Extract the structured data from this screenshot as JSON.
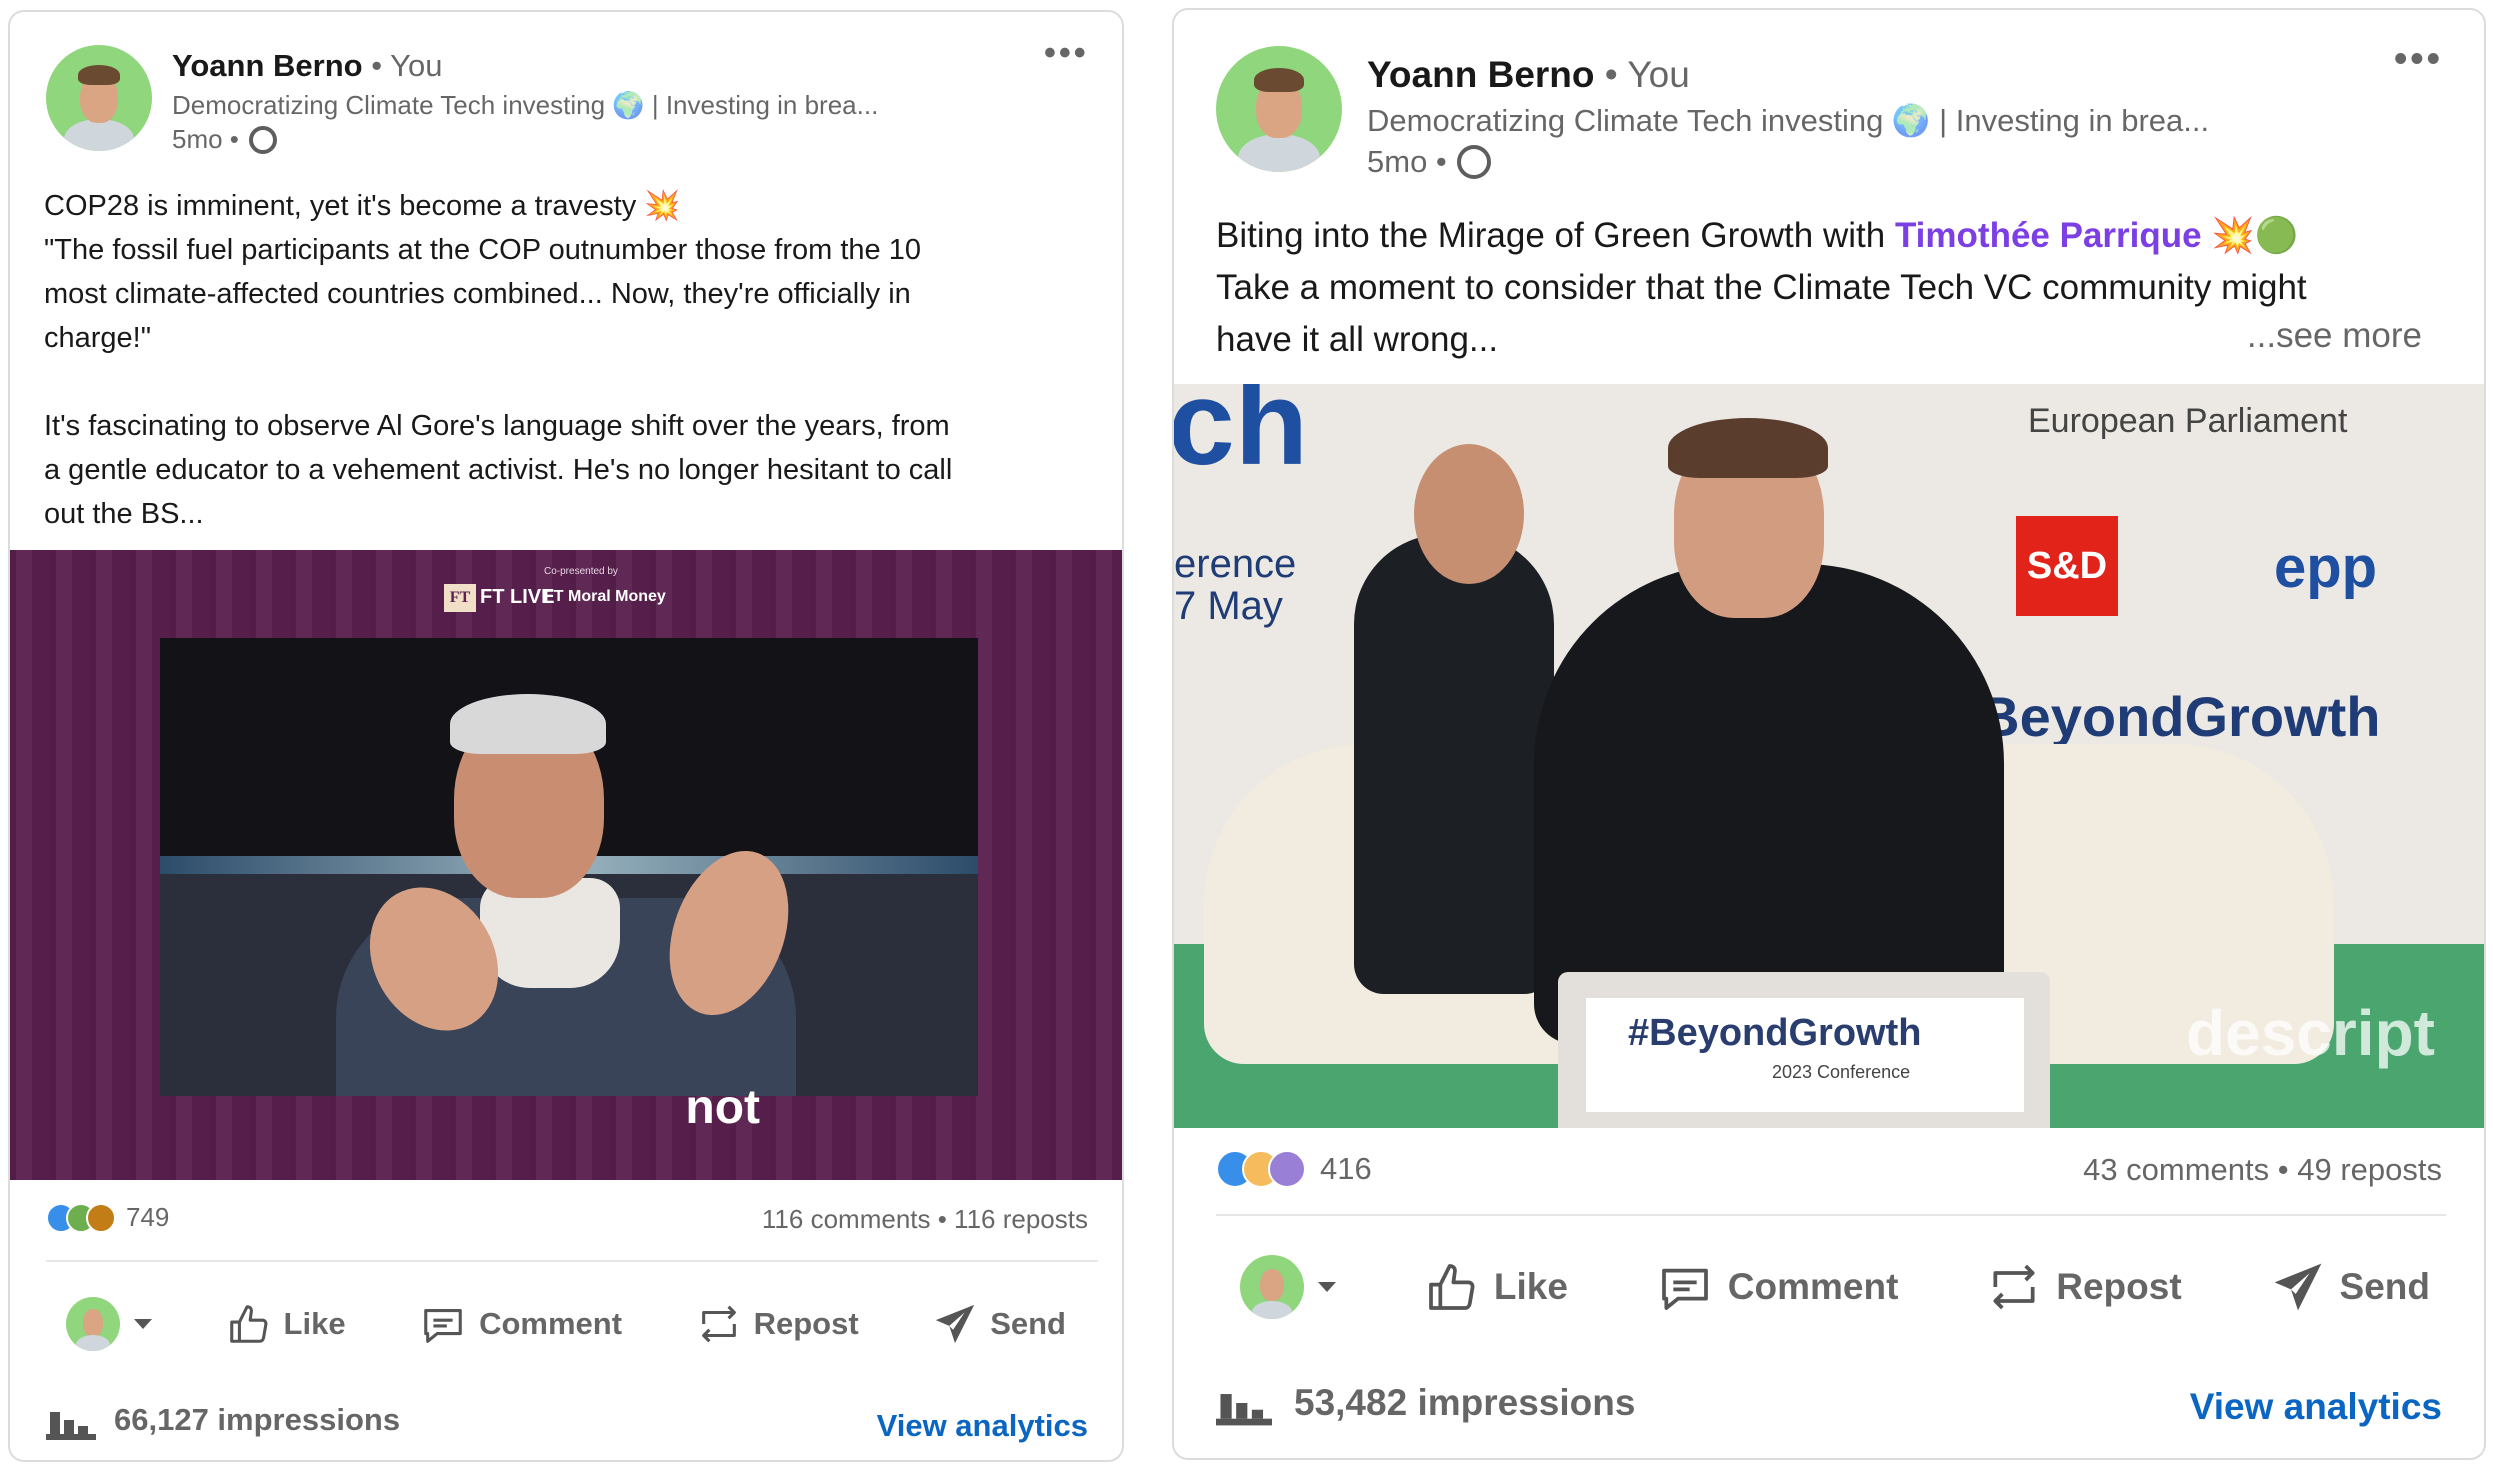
{
  "colors": {
    "link": "#0a66c2",
    "mention": "#7b3fe4",
    "purple": "#5b2150",
    "muted": "#666666"
  },
  "posts": [
    {
      "author": {
        "name": "Yoann Berno",
        "you": "• You",
        "headline": "Democratizing Climate Tech investing 🌍 | Investing in brea...",
        "time": "5mo •"
      },
      "text": "COP28 is imminent, yet it's become a travesty 💥\n\"The fossil fuel participants at the COP outnumber those from the 10\nmost climate-affected countries combined... Now, they're officially in\ncharge!\"\n\nIt's fascinating to observe Al Gore's language shift over the years, from\na gentle educator to a vehement activist. He's no longer hesitant to call\nout the BS...",
      "video": {
        "ft_live": "FT LIVE",
        "copresented": "Co-presented by",
        "moral_money": "FT Moral Money",
        "caption": "not"
      },
      "reactions_count": "749",
      "comments_reposts": "116 comments • 116 reposts",
      "actions": {
        "like": "Like",
        "comment": "Comment",
        "repost": "Repost",
        "send": "Send"
      },
      "impressions": "66,127 impressions",
      "view_analytics": "View analytics"
    },
    {
      "author": {
        "name": "Yoann Berno",
        "you": "• You",
        "headline": "Democratizing Climate Tech investing 🌍 | Investing in brea...",
        "time": "5mo •"
      },
      "text_before": "Biting into the Mirage of Green Growth with ",
      "mention": "Timothée Parrique",
      "text_after": " 💥🟢\nTake a moment to consider that the Climate Tech VC community might\nhave it all wrong...",
      "see_more": "...see more",
      "video": {
        "ch": "ch",
        "erence": "erence",
        "may": "7 May",
        "parliament": "European Parliament",
        "sd": "S&D",
        "epp": "epp",
        "hashtag": "#BeyondGrowth",
        "podium_tag": "#BeyondGrowth",
        "conference": "2023 Conference",
        "watermark": "descript"
      },
      "reactions_count": "416",
      "comments_reposts": "43 comments • 49 reposts",
      "actions": {
        "like": "Like",
        "comment": "Comment",
        "repost": "Repost",
        "send": "Send"
      },
      "impressions": "53,482 impressions",
      "view_analytics": "View analytics"
    }
  ]
}
